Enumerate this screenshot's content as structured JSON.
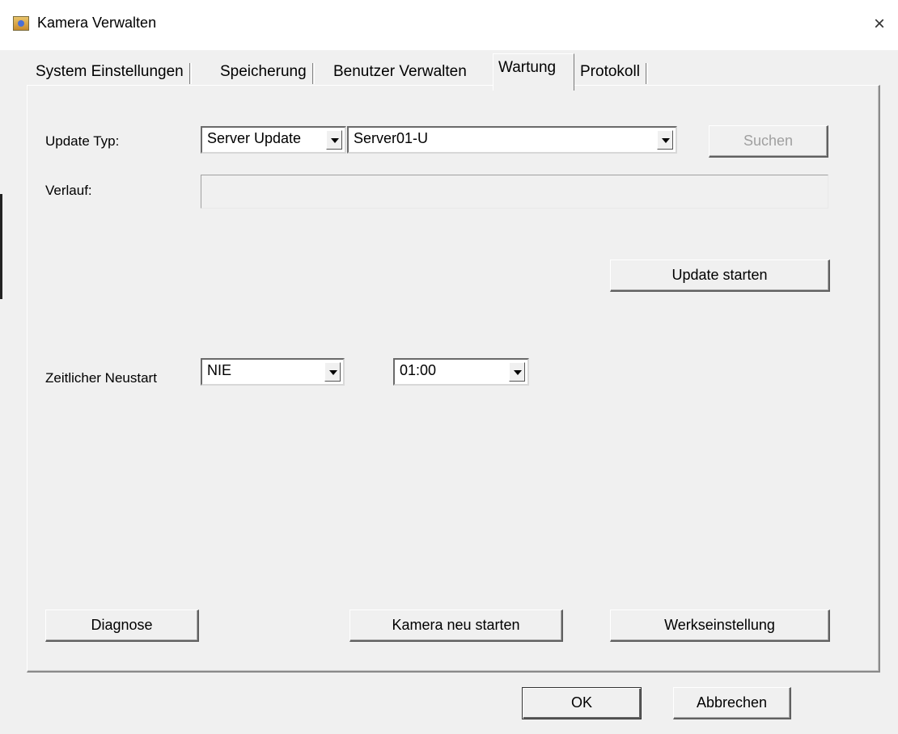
{
  "window": {
    "title": "Kamera Verwalten",
    "close_glyph": "×"
  },
  "tabs": [
    {
      "label": "System Einstellungen"
    },
    {
      "label": "Speicherung"
    },
    {
      "label": "Benutzer Verwalten"
    },
    {
      "label": "Wartung",
      "active": true
    },
    {
      "label": "Protokoll"
    }
  ],
  "update": {
    "type_label": "Update Typ:",
    "type_value": "Server Update",
    "server_value": "Server01-U",
    "search_label": "Suchen",
    "progress_label": "Verlauf:",
    "start_label": "Update starten"
  },
  "restart": {
    "label": "Zeitlicher Neustart",
    "frequency_value": "NIE",
    "time_value": "01:00"
  },
  "actions": {
    "diagnose_label": "Diagnose",
    "reboot_label": "Kamera neu starten",
    "factory_label": "Werkseinstellung"
  },
  "footer": {
    "ok_label": "OK",
    "cancel_label": "Abbrechen"
  },
  "icons": {
    "app": "camera-app-icon",
    "close": "close-icon",
    "dropdown": "chevron-down-icon"
  }
}
